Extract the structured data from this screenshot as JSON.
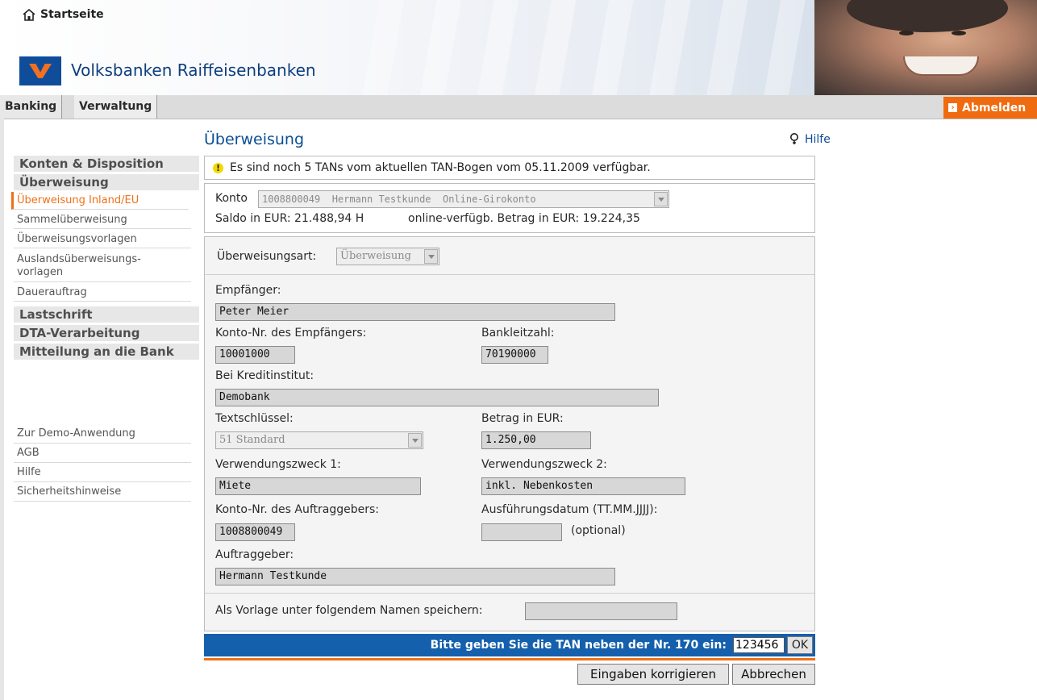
{
  "header": {
    "home_label": "Startseite",
    "bank_name": "Volksbanken Raiffeisenbanken",
    "logo_text": "VR"
  },
  "tabs": [
    {
      "label": "Banking",
      "active": true
    },
    {
      "label": "Verwaltung",
      "active": false
    }
  ],
  "logout_label": "Abmelden",
  "sidebar": {
    "sections": [
      {
        "label": "Konten & Disposition"
      },
      {
        "label": "Überweisung"
      },
      {
        "label": "Lastschrift"
      },
      {
        "label": "DTA-Verarbeitung"
      },
      {
        "label": "Mitteilung an die Bank"
      }
    ],
    "ueberweisung_items": [
      {
        "label": "Überweisung Inland/EU",
        "active": true
      },
      {
        "label": "Sammelüberweisung"
      },
      {
        "label": "Überweisungsvorlagen"
      },
      {
        "label": "Auslandsüberweisungs-"
      },
      {
        "label": "vorlagen"
      },
      {
        "label": "Dauerauftrag"
      }
    ],
    "footer_links": [
      {
        "label": "Zur Demo-Anwendung"
      },
      {
        "label": "AGB"
      },
      {
        "label": "Hilfe"
      },
      {
        "label": "Sicherheitshinweise"
      }
    ]
  },
  "main": {
    "title": "Überweisung",
    "help_label": "Hilfe",
    "tan_notice": "Es sind noch 5 TANs vom aktuellen TAN-Bogen vom 05.11.2009 verfügbar.",
    "account": {
      "label": "Konto",
      "selected": "1008800049  Hermann Testkunde  Online-Girokonto",
      "saldo": "Saldo in EUR:  21.488,94 H",
      "available": "online-verfügb. Betrag in EUR:  19.224,35"
    },
    "form": {
      "transfer_type_label": "Überweisungsart:",
      "transfer_type_value": "Überweisung",
      "recipient_label": "Empfänger:",
      "recipient_value": "Peter Meier",
      "recipient_account_label": "Konto-Nr. des Empfängers:",
      "recipient_account_value": "10001000",
      "bank_code_label": "Bankleitzahl:",
      "bank_code_value": "70190000",
      "institute_label": "Bei Kreditinstitut:",
      "institute_value": "Demobank",
      "text_key_label": "Textschlüssel:",
      "text_key_value": "51 Standard",
      "amount_label": "Betrag in EUR:",
      "amount_value": "1.250,00",
      "purpose1_label": "Verwendungszweck 1:",
      "purpose1_value": "Miete",
      "purpose2_label": "Verwendungszweck 2:",
      "purpose2_value": "inkl. Nebenkosten",
      "payer_account_label": "Konto-Nr. des Auftraggebers:",
      "payer_account_value": "1008800049",
      "exec_date_label": "Ausführungsdatum (TT.MM.JJJJ):",
      "exec_date_value": "",
      "exec_date_hint": "(optional)",
      "payer_label": "Auftraggeber:",
      "payer_value": "Hermann Testkunde",
      "template_label": "Als Vorlage unter folgendem Namen speichern:",
      "template_value": ""
    },
    "tan_prompt": "Bitte geben Sie die TAN neben der Nr. 170 ein:",
    "tan_value": "123456",
    "ok_label": "OK",
    "correct_button": "Eingaben korrigieren",
    "cancel_button": "Abbrechen"
  },
  "colors": {
    "brand_blue": "#0b4e95",
    "accent_orange": "#f07018",
    "tan_bar_blue": "#1560ad"
  }
}
